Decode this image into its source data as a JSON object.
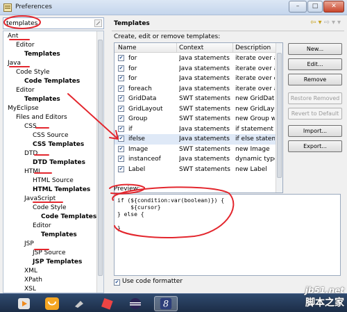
{
  "window": {
    "title": "Preferences",
    "buttons": {
      "minimize": "–",
      "maximize": "□",
      "close": "✕"
    }
  },
  "filter": {
    "value": "templates"
  },
  "tree": [
    {
      "label": "Ant",
      "bold": false,
      "indent": 0
    },
    {
      "label": "Editor",
      "bold": false,
      "indent": 1
    },
    {
      "label": "Templates",
      "bold": true,
      "indent": 2
    },
    {
      "label": "Java",
      "bold": false,
      "indent": 0
    },
    {
      "label": "Code Style",
      "bold": false,
      "indent": 1
    },
    {
      "label": "Code Templates",
      "bold": true,
      "indent": 2
    },
    {
      "label": "Editor",
      "bold": false,
      "indent": 1
    },
    {
      "label": "Templates",
      "bold": true,
      "indent": 2
    },
    {
      "label": "MyEclipse",
      "bold": false,
      "indent": 0
    },
    {
      "label": "Files and Editors",
      "bold": false,
      "indent": 1
    },
    {
      "label": "CSS",
      "bold": false,
      "indent": 2
    },
    {
      "label": "CSS Source",
      "bold": false,
      "indent": 3
    },
    {
      "label": "CSS Templates",
      "bold": true,
      "indent": 3
    },
    {
      "label": "DTD",
      "bold": false,
      "indent": 2
    },
    {
      "label": "DTD Templates",
      "bold": true,
      "indent": 3
    },
    {
      "label": "HTML",
      "bold": false,
      "indent": 2
    },
    {
      "label": "HTML Source",
      "bold": false,
      "indent": 3
    },
    {
      "label": "HTML Templates",
      "bold": true,
      "indent": 3
    },
    {
      "label": "JavaScript",
      "bold": false,
      "indent": 2
    },
    {
      "label": "Code Style",
      "bold": false,
      "indent": 3
    },
    {
      "label": "Code Templates",
      "bold": true,
      "indent": 4
    },
    {
      "label": "Editor",
      "bold": false,
      "indent": 3
    },
    {
      "label": "Templates",
      "bold": true,
      "indent": 4
    },
    {
      "label": "JSP",
      "bold": false,
      "indent": 2
    },
    {
      "label": "JSP Source",
      "bold": false,
      "indent": 3
    },
    {
      "label": "JSP Templates",
      "bold": true,
      "indent": 3
    },
    {
      "label": "XML",
      "bold": false,
      "indent": 2
    },
    {
      "label": "XPath",
      "bold": false,
      "indent": 2
    },
    {
      "label": "XSL",
      "bold": false,
      "indent": 2
    }
  ],
  "page": {
    "title": "Templates",
    "description": "Create, edit or remove templates:"
  },
  "table": {
    "columns": [
      "Name",
      "Context",
      "Description"
    ],
    "rows": [
      {
        "checked": true,
        "name": "for",
        "context": "Java statements",
        "description": "iterate over ar...",
        "selected": false
      },
      {
        "checked": true,
        "name": "for",
        "context": "Java statements",
        "description": "iterate over ar...",
        "selected": false
      },
      {
        "checked": true,
        "name": "for",
        "context": "Java statements",
        "description": "iterate over c...",
        "selected": false
      },
      {
        "checked": true,
        "name": "foreach",
        "context": "Java statements",
        "description": "iterate over an...",
        "selected": false
      },
      {
        "checked": true,
        "name": "GridData",
        "context": "SWT statements",
        "description": "new GridData ...",
        "selected": false
      },
      {
        "checked": true,
        "name": "GridLayout",
        "context": "SWT statements",
        "description": "new GridLayo...",
        "selected": false
      },
      {
        "checked": true,
        "name": "Group",
        "context": "SWT statements",
        "description": "new Group wit...",
        "selected": false
      },
      {
        "checked": true,
        "name": "if",
        "context": "Java statements",
        "description": "if statement",
        "selected": false
      },
      {
        "checked": true,
        "name": "ifelse",
        "context": "Java statements",
        "description": "if else stateme...",
        "selected": true
      },
      {
        "checked": true,
        "name": "Image",
        "context": "SWT statements",
        "description": "new Image",
        "selected": false
      },
      {
        "checked": true,
        "name": "instanceof",
        "context": "Java statements",
        "description": "dynamic type ...",
        "selected": false
      },
      {
        "checked": true,
        "name": "Label",
        "context": "SWT statements",
        "description": "new Label",
        "selected": false
      }
    ]
  },
  "buttons": {
    "new": "New...",
    "edit": "Edit...",
    "remove": "Remove",
    "restore_removed": "Restore Removed",
    "revert_default": "Revert to Default",
    "import": "Import...",
    "export": "Export..."
  },
  "preview": {
    "label": "Preview:",
    "lines": [
      "if (${condition:var(boolean)}) {",
      "    ${cursor}",
      "} else {",
      "",
      "}"
    ]
  },
  "formatter": {
    "label": "Use code formatter",
    "checked": true
  },
  "ok_button": "",
  "taskbar": {
    "icons": [
      "media-player-icon",
      "uc-browser-icon",
      "tool-icon",
      "paint-icon",
      "eclipse-icon",
      "myeclipse-icon"
    ]
  },
  "watermark": {
    "site": "jb51.net",
    "text": "脚本之家"
  },
  "colors": {
    "annotation_red": "#e3262d",
    "selection_bg": "#dfe9f7",
    "keyword": "#7f0055"
  }
}
